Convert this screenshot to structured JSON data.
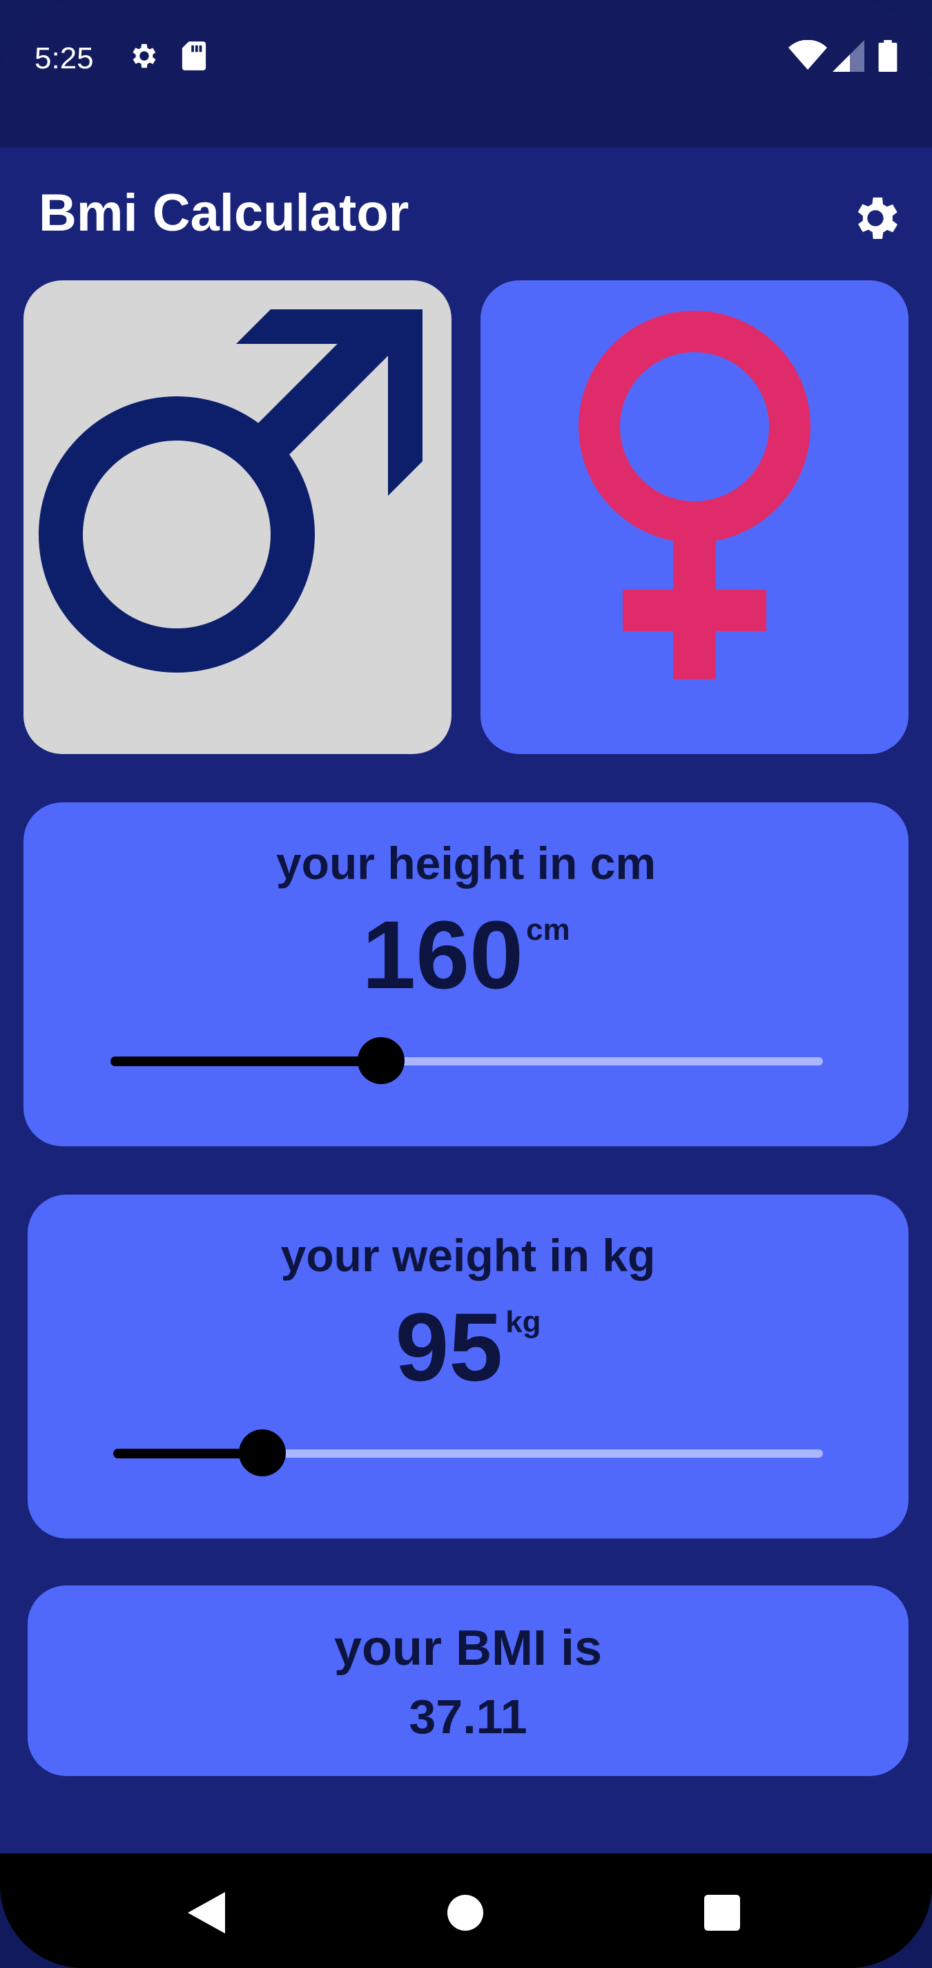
{
  "status_bar": {
    "time": "5:25",
    "icons": [
      "gear-icon",
      "sd-card-icon",
      "wifi-icon",
      "signal-icon",
      "battery-icon"
    ]
  },
  "app_bar": {
    "title": "Bmi Calculator",
    "action_icon": "gear-icon"
  },
  "gender": {
    "male": {
      "icon": "male-symbol-icon",
      "selected": true,
      "color": "#0d1f6b"
    },
    "female": {
      "icon": "female-symbol-icon",
      "selected": false,
      "color": "#e02b6a"
    }
  },
  "height": {
    "label": "your height in cm",
    "value": "160",
    "unit": "cm",
    "slider_fraction": 0.38
  },
  "weight": {
    "label": "your weight in kg",
    "value": "95",
    "unit": "kg",
    "slider_fraction": 0.21
  },
  "result": {
    "label": "your BMI is",
    "value": "37.11"
  },
  "nav_bar": {
    "icons": [
      "back-icon",
      "home-icon",
      "recents-icon"
    ]
  },
  "colors": {
    "background": "#19237a",
    "card_blue": "#5169fb",
    "card_selected": "#d6d6d6",
    "text_dark": "#0e1440"
  }
}
